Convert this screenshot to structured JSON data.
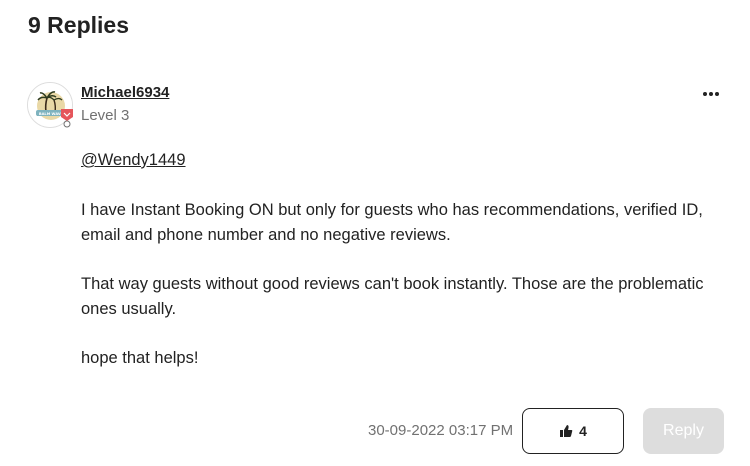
{
  "header": {
    "replies_title": "9 Replies"
  },
  "post": {
    "author": {
      "username": "Michael6934",
      "level": "Level 3",
      "avatar_text": "BALM WAVE"
    },
    "mention": "@Wendy1449",
    "paragraphs": [
      "I have Instant Booking ON but only for guests who has recommendations, verified ID, email and phone number and no negative reviews.",
      "That way guests without good reviews can't book instantly. Those are the problematic ones usually.",
      "hope that helps!"
    ],
    "timestamp": "30-09-2022 03:17 PM",
    "like_count": "4",
    "reply_label": "Reply"
  },
  "colors": {
    "text": "#222222",
    "muted": "#717171",
    "reply_button_bg": "#dddddd",
    "badge": "#e5565b"
  },
  "icons": [
    "more-options-icon",
    "thumbs-up-icon",
    "level-badge-icon"
  ]
}
